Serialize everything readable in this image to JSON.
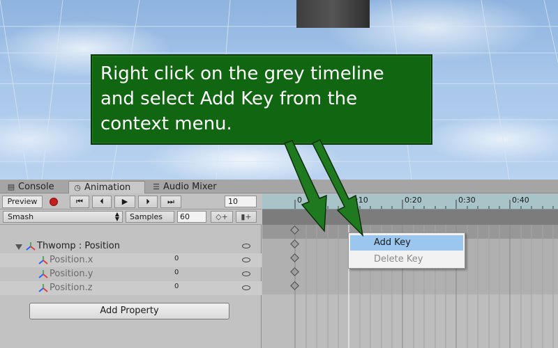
{
  "callout": {
    "line1": "Right click on the grey timeline",
    "line2": "and select Add Key from the",
    "line3": "context menu."
  },
  "tabs": [
    {
      "label": "Console",
      "icon": "console-icon"
    },
    {
      "label": "Animation",
      "icon": "clock-icon"
    },
    {
      "label": "Audio Mixer",
      "icon": "mixer-icon"
    }
  ],
  "toolbar": {
    "preview_label": "Preview",
    "record_icon": "record-icon",
    "first_frame_icon": "first-frame-icon",
    "prev_frame_icon": "prev-frame-icon",
    "play_icon": "play-icon",
    "next_frame_icon": "next-frame-icon",
    "last_frame_icon": "last-frame-icon",
    "frame_value": "10"
  },
  "row2": {
    "clip_name": "Smash",
    "samples_label": "Samples",
    "samples_value": "60",
    "add_keyframe_icon": "add-keyframe-icon",
    "add_event_icon": "add-event-icon"
  },
  "properties": {
    "group_label": "Thwomp : Position",
    "items": [
      {
        "label": "Position.x",
        "value": "0"
      },
      {
        "label": "Position.y",
        "value": "0"
      },
      {
        "label": "Position.z",
        "value": "0"
      }
    ],
    "add_property_label": "Add Property"
  },
  "ruler": {
    "labels": [
      "0",
      "0:10",
      "0:20",
      "0:30",
      "0:40"
    ]
  },
  "context_menu": {
    "add_key": "Add Key",
    "delete_key": "Delete Key"
  },
  "colors": {
    "callout_bg": "#116611",
    "arrow": "#1f7a1f",
    "record": "#c41d1d",
    "menu_highlight": "#9bc7ee"
  }
}
